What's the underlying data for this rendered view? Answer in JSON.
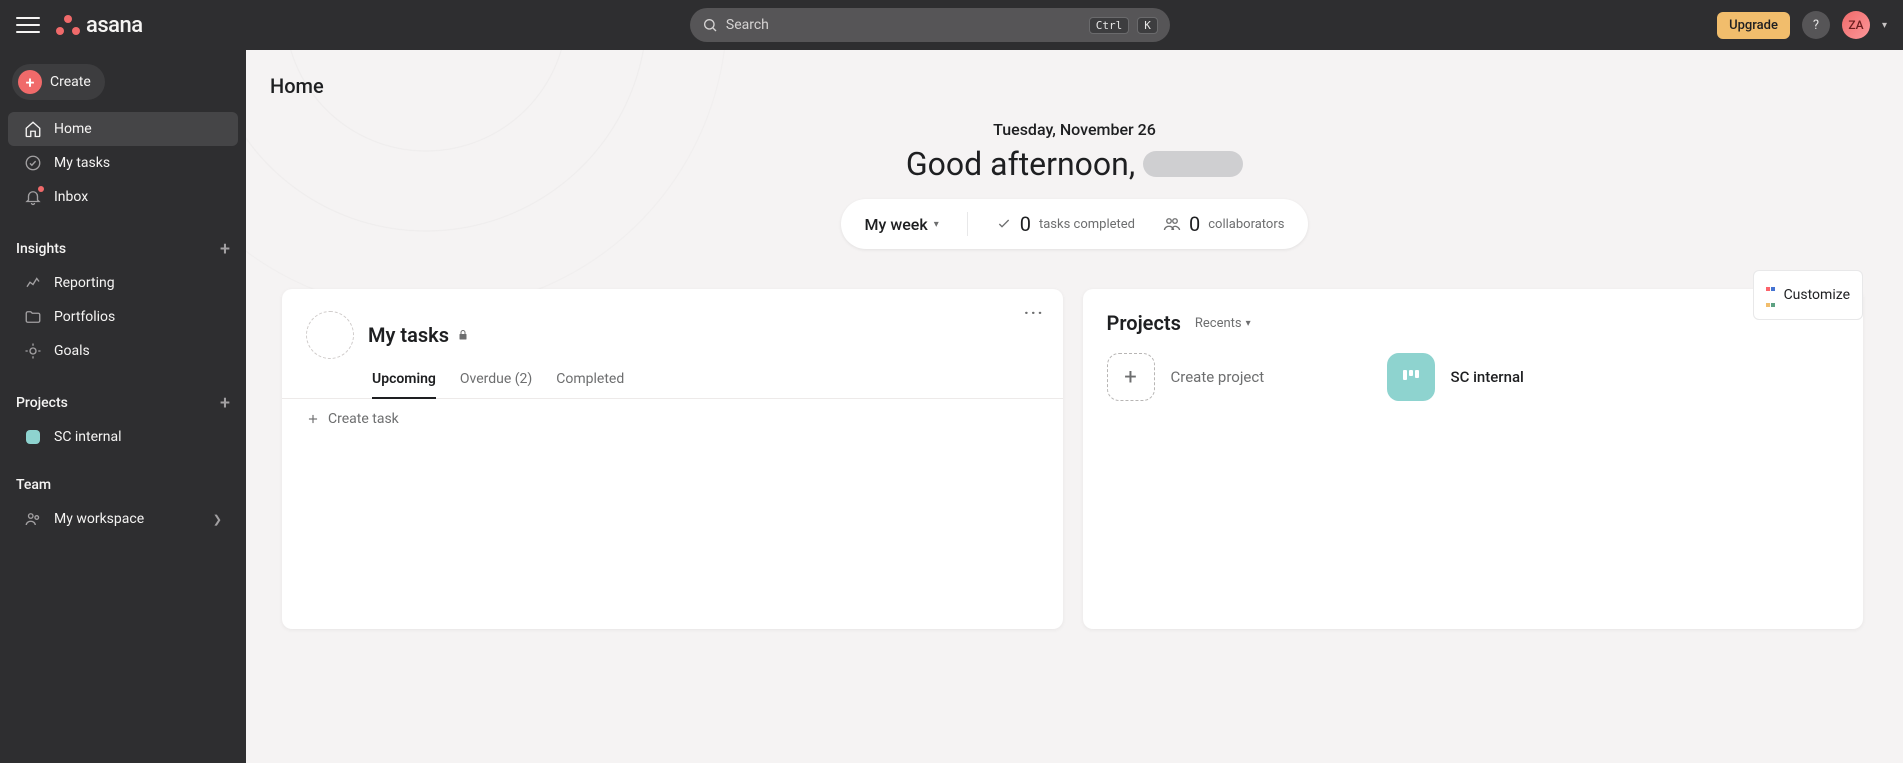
{
  "topbar": {
    "logo_text": "asana",
    "search_placeholder": "Search",
    "kbd_ctrl": "Ctrl",
    "kbd_k": "K",
    "upgrade": "Upgrade",
    "help": "?",
    "avatar_initials": "ZA"
  },
  "sidebar": {
    "create": "Create",
    "nav": {
      "home": "Home",
      "my_tasks": "My tasks",
      "inbox": "Inbox"
    },
    "insights": {
      "title": "Insights",
      "reporting": "Reporting",
      "portfolios": "Portfolios",
      "goals": "Goals"
    },
    "projects": {
      "title": "Projects",
      "items": [
        "SC internal"
      ]
    },
    "team": {
      "title": "Team",
      "workspace": "My workspace"
    }
  },
  "main": {
    "page_title": "Home",
    "date": "Tuesday, November 26",
    "greeting": "Good afternoon,",
    "stats": {
      "my_week": "My week",
      "tasks_count": "0",
      "tasks_label": "tasks completed",
      "collab_count": "0",
      "collab_label": "collaborators"
    },
    "customize": "Customize",
    "my_tasks_card": {
      "title": "My tasks",
      "tabs": {
        "upcoming": "Upcoming",
        "overdue": "Overdue (2)",
        "completed": "Completed"
      },
      "create_task": "Create task"
    },
    "projects_card": {
      "title": "Projects",
      "recents": "Recents",
      "create_project": "Create project",
      "project_name": "SC internal"
    }
  }
}
